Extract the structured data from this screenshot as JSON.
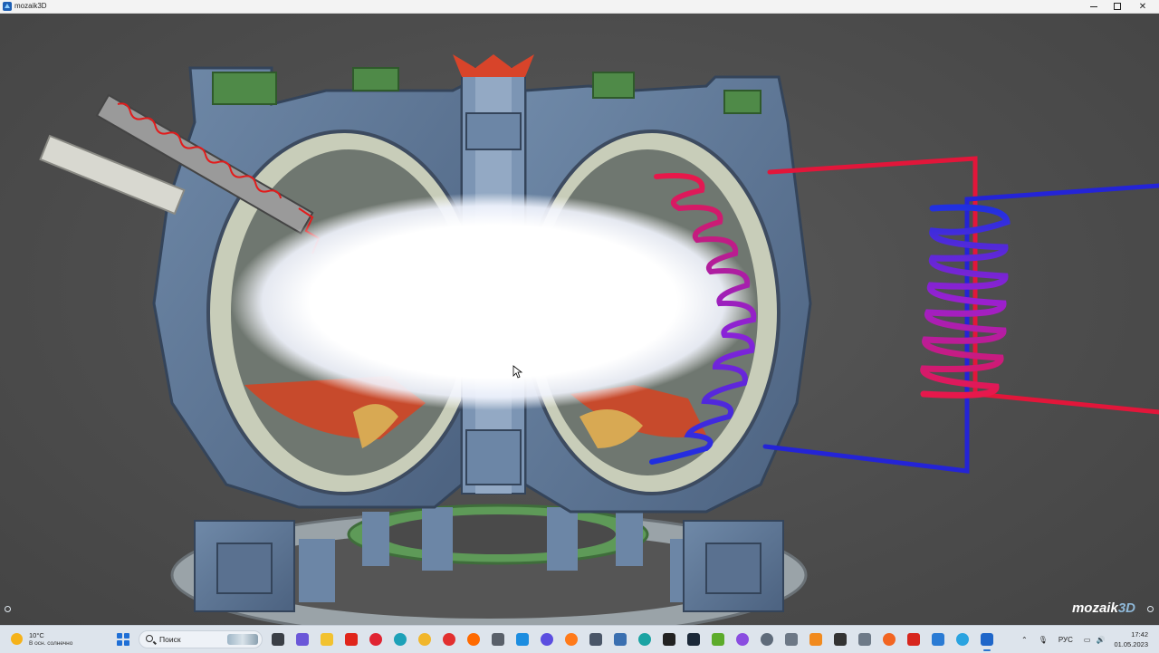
{
  "window": {
    "title": "mozaik3D",
    "minimize_icon": "minimize-icon",
    "maximize_icon": "restore-icon",
    "close_icon": "close-icon"
  },
  "viewport": {
    "brand_main": "mozaik",
    "brand_accent": "3D"
  },
  "colors": {
    "hot_coil": "#e2163a",
    "cold_coil": "#2424d6",
    "vessel": "#5f7898",
    "background": "#4d4d4d",
    "plasma": "#ffffff"
  },
  "taskbar": {
    "weather": {
      "temperature": "10°C",
      "condition": "В осн. солнечно"
    },
    "search_label": "Поиск",
    "apps": [
      "file-manager-icon",
      "chat-icon",
      "folder-icon",
      "yandex-browser-icon",
      "opera-icon",
      "edge-icon",
      "chrome-icon",
      "yandex-icon",
      "media-icon",
      "video-icon",
      "store-icon",
      "photos-icon",
      "prime-video-icon",
      "firefox-icon",
      "app-icon",
      "edge-dev-icon",
      "epic-games-icon",
      "steam-icon",
      "nvidia-icon",
      "alice-icon",
      "settings-icon",
      "camera-icon",
      "vlc-icon",
      "game-icon",
      "calculator-icon",
      "origin-icon",
      "app-red-icon",
      "notepad-icon",
      "telegram-icon",
      "mozaik-icon"
    ],
    "language": "РУС",
    "time": "17:42",
    "date": "01.05.2023"
  }
}
